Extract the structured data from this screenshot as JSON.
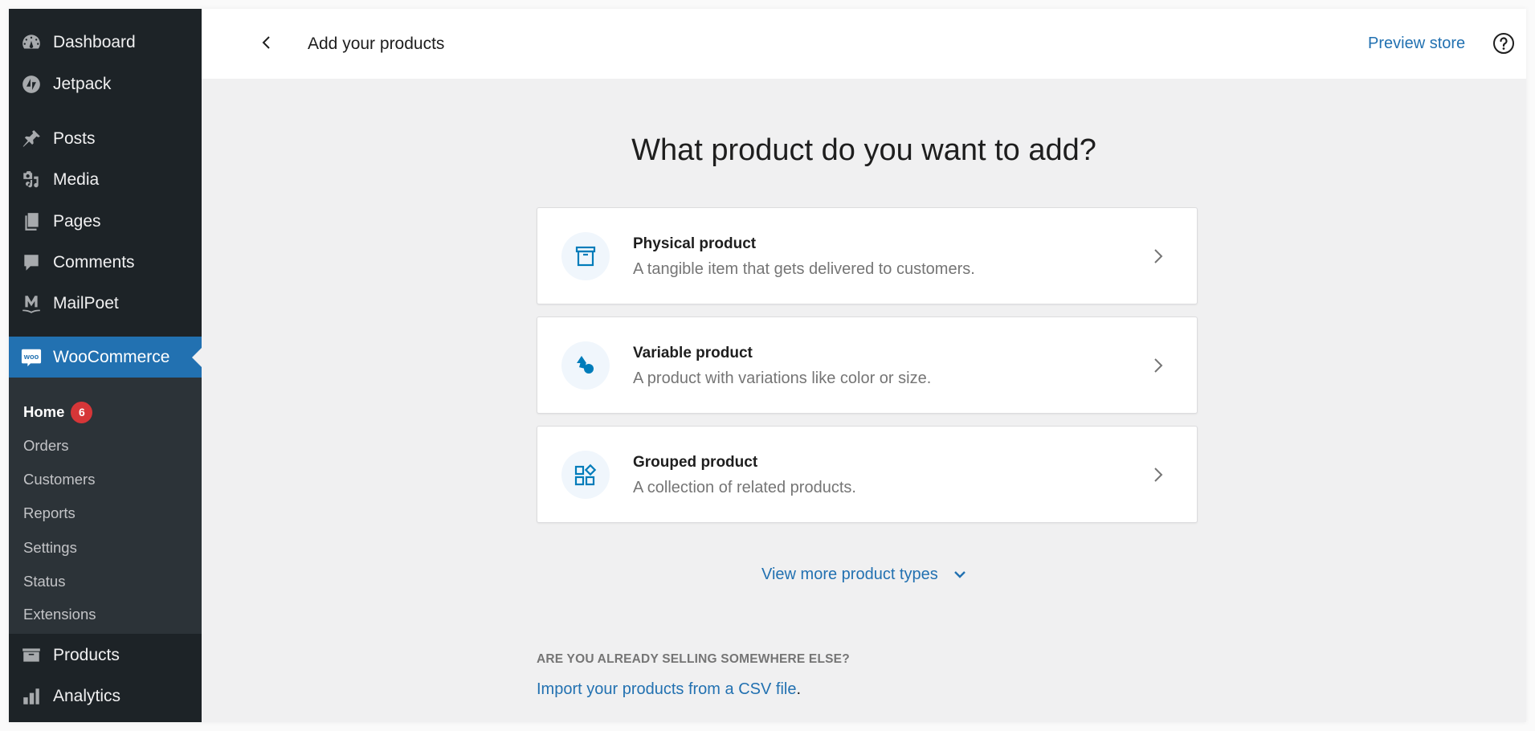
{
  "sidebar": {
    "items": [
      {
        "label": "Dashboard",
        "icon": "dashboard-icon"
      },
      {
        "label": "Jetpack",
        "icon": "jetpack-icon"
      },
      {
        "label": "Posts",
        "icon": "pin-icon"
      },
      {
        "label": "Media",
        "icon": "media-icon"
      },
      {
        "label": "Pages",
        "icon": "pages-icon"
      },
      {
        "label": "Comments",
        "icon": "comment-icon"
      },
      {
        "label": "MailPoet",
        "icon": "mailpoet-icon"
      },
      {
        "label": "WooCommerce",
        "icon": "woo-icon",
        "active": true
      },
      {
        "label": "Products",
        "icon": "archive-icon"
      },
      {
        "label": "Analytics",
        "icon": "bar-chart-icon"
      }
    ],
    "woo_icon_text": "woo",
    "submenu": [
      {
        "label": "Home",
        "current": true,
        "badge": "6"
      },
      {
        "label": "Orders"
      },
      {
        "label": "Customers"
      },
      {
        "label": "Reports"
      },
      {
        "label": "Settings"
      },
      {
        "label": "Status"
      },
      {
        "label": "Extensions"
      }
    ]
  },
  "header": {
    "title": "Add your products",
    "back_icon": "chevron-left-icon",
    "preview_label": "Preview store",
    "help_icon": "help-icon"
  },
  "main": {
    "title": "What product do you want to add?",
    "cards": [
      {
        "title": "Physical product",
        "description": "A tangible item that gets delivered to customers.",
        "icon": "box-icon"
      },
      {
        "title": "Variable product",
        "description": "A product with variations like color or size.",
        "icon": "shapes-icon"
      },
      {
        "title": "Grouped product",
        "description": "A collection of related products.",
        "icon": "group-blocks-icon"
      }
    ],
    "view_more_label": "View more product types",
    "selling_label": "ARE YOU ALREADY SELLING SOMEWHERE ELSE?",
    "import_link": "Import your products from a CSV file",
    "import_suffix": "."
  },
  "colors": {
    "accent": "#2271b1",
    "sidebar_bg": "#1d2327",
    "submenu_bg": "#2c3338",
    "badge": "#d63638",
    "icon_blue": "#007cba"
  }
}
